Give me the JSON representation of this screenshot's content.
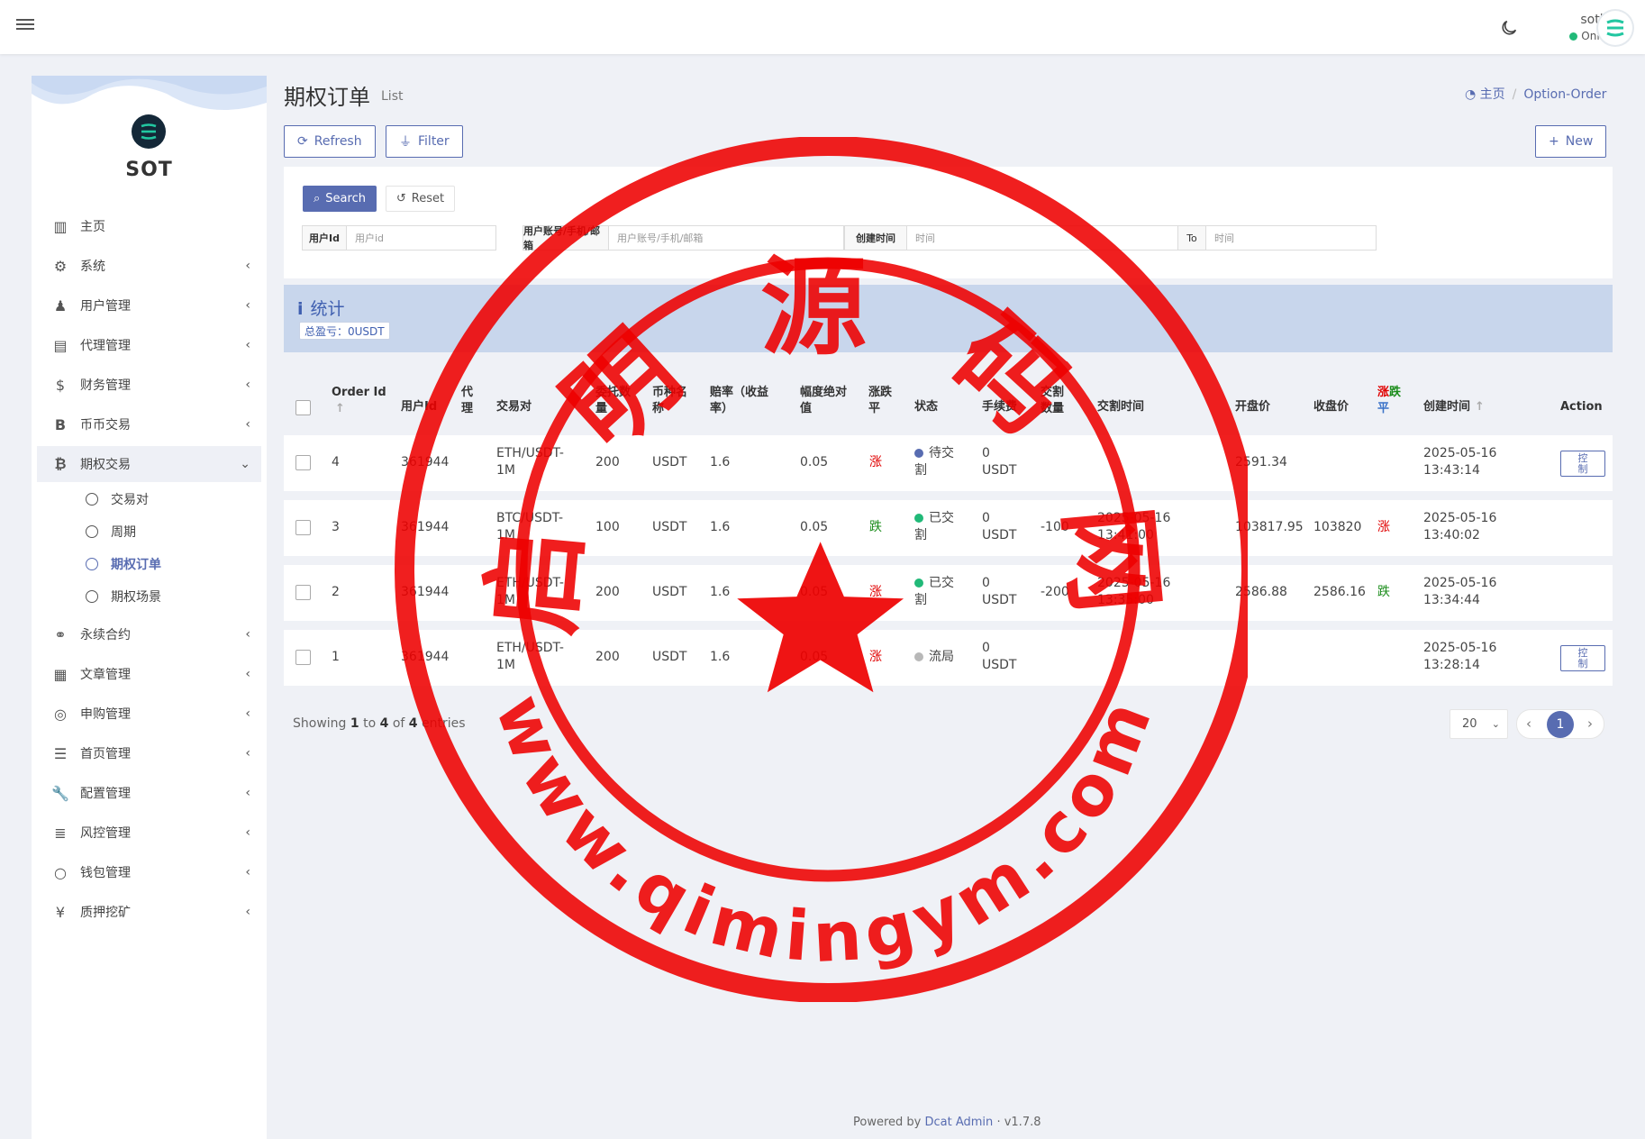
{
  "navbar": {
    "user_name": "sotbit",
    "user_status": "Online"
  },
  "sidebar": {
    "brand": "SOT",
    "menu": [
      {
        "label": "主页",
        "icon": "bar-chart-icon"
      },
      {
        "label": "系统",
        "icon": "gear-icon"
      },
      {
        "label": "用户管理",
        "icon": "users-icon"
      },
      {
        "label": "代理管理",
        "icon": "id-card-icon"
      },
      {
        "label": "财务管理",
        "icon": "dollar-icon"
      },
      {
        "label": "币币交易",
        "icon": "bitcoin-icon"
      },
      {
        "label": "期权交易",
        "icon": "bitcoin-icon"
      }
    ],
    "submenu": [
      {
        "label": "交易对"
      },
      {
        "label": "周期"
      },
      {
        "label": "期权订单"
      },
      {
        "label": "期权场景"
      }
    ],
    "menu2": [
      {
        "label": "永续合约",
        "icon": "link-icon"
      },
      {
        "label": "文章管理",
        "icon": "newspaper-icon"
      },
      {
        "label": "申购管理",
        "icon": "lifebuoy-icon"
      },
      {
        "label": "首页管理",
        "icon": "list-icon"
      },
      {
        "label": "配置管理",
        "icon": "wrench-icon"
      },
      {
        "label": "风控管理",
        "icon": "indent-icon"
      },
      {
        "label": "钱包管理",
        "icon": "circle-icon"
      },
      {
        "label": "质押挖矿",
        "icon": "yen-icon"
      }
    ]
  },
  "header": {
    "title": "期权订单",
    "subtitle": "List",
    "breadcrumb_home": "主页",
    "breadcrumb_current": "Option-Order"
  },
  "toolbar": {
    "refresh": "Refresh",
    "filter": "Filter",
    "new": "New"
  },
  "filter": {
    "search": "Search",
    "reset": "Reset",
    "uid_label": "用户Id",
    "uid_placeholder": "用户id",
    "account_label": "用户账号/手机/邮箱",
    "account_placeholder": "用户账号/手机/邮箱",
    "created_label": "创建时间",
    "time_placeholder": "时间",
    "to_label": "To",
    "to_placeholder": "时间"
  },
  "stats": {
    "title": "统计",
    "total_pnl": "总盈亏：0USDT"
  },
  "table": {
    "headers": {
      "order_id": "Order Id",
      "user": "用户Id",
      "agent": "代理",
      "pair": "交易对",
      "amount": "委托数量",
      "coin": "币种名称",
      "odds": "赔率（收益率）",
      "range": "幅度绝对值",
      "direction": "涨跌平",
      "status": "状态",
      "fee": "手续费",
      "delivery": "交割数量",
      "delivery_time": "交割时间",
      "open_price": "开盘价",
      "close_price": "收盘价",
      "result_up": "涨",
      "result_down": "跌",
      "result_flat": "平",
      "created": "创建时间",
      "action": "Action"
    },
    "rows": [
      {
        "id": "4",
        "user": "361944",
        "pair_1": "ETH/USDT-",
        "pair_2": "1M",
        "amount": "200",
        "coin": "USDT",
        "odds": "1.6",
        "range": "0.05",
        "direction": "涨",
        "status_1": "待交",
        "status_2": "割",
        "status_color": "#586cb1",
        "fee_1": "0",
        "fee_2": "USDT",
        "delivery": "",
        "dt_1": "",
        "dt_2": "",
        "open": "2591.34",
        "close": "",
        "result": "",
        "created_1": "2025-05-16",
        "created_2": "13:43:14",
        "action": "控制"
      },
      {
        "id": "3",
        "user": "361944",
        "pair_1": "BTC/USDT-",
        "pair_2": "1M",
        "amount": "100",
        "coin": "USDT",
        "odds": "1.6",
        "range": "0.05",
        "direction": "跌",
        "status_1": "已交",
        "status_2": "割",
        "status_color": "#21b978",
        "fee_1": "0",
        "fee_2": "USDT",
        "delivery": "-100",
        "dt_1": "2025-05-16",
        "dt_2": "13:41:00",
        "open": "103817.95",
        "close": "103820",
        "result": "涨",
        "created_1": "2025-05-16",
        "created_2": "13:40:02",
        "action": ""
      },
      {
        "id": "2",
        "user": "361944",
        "pair_1": "ETH/USDT-",
        "pair_2": "1M",
        "amount": "200",
        "coin": "USDT",
        "odds": "1.6",
        "range": "0.05",
        "direction": "涨",
        "status_1": "已交",
        "status_2": "割",
        "status_color": "#21b978",
        "fee_1": "0",
        "fee_2": "USDT",
        "delivery": "-200",
        "dt_1": "2025-05-16",
        "dt_2": "13:35:00",
        "open": "2586.88",
        "close": "2586.16",
        "result": "跌",
        "created_1": "2025-05-16",
        "created_2": "13:34:44",
        "action": ""
      },
      {
        "id": "1",
        "user": "361944",
        "pair_1": "ETH/USDT-",
        "pair_2": "1M",
        "amount": "200",
        "coin": "USDT",
        "odds": "1.6",
        "range": "0.05",
        "direction": "涨",
        "status_1": "流局",
        "status_2": "",
        "status_color": "#b8b8b8",
        "fee_1": "0",
        "fee_2": "USDT",
        "delivery": "",
        "dt_1": "",
        "dt_2": "",
        "open": "",
        "close": "",
        "result": "",
        "created_1": "2025-05-16",
        "created_2": "13:28:14",
        "action": "控制"
      }
    ]
  },
  "pagination": {
    "showing": "Showing",
    "from": "1",
    "to_word": "to",
    "to": "4",
    "of_word": "of",
    "total": "4",
    "entries": "entries",
    "per_page": "20",
    "current": "1"
  },
  "footer": {
    "powered_by": "Powered by",
    "link": "Dcat Admin",
    "sep": "·",
    "version": "v1.7.8"
  },
  "watermark": {
    "text_top": "启 明 源 码 网",
    "text_bottom": "www.qimingym.com"
  },
  "colors": {
    "primary": "#586cb1",
    "stamp": "#ee0000",
    "success": "#21b978",
    "up": "#e00000",
    "down": "#1a8c1a"
  }
}
